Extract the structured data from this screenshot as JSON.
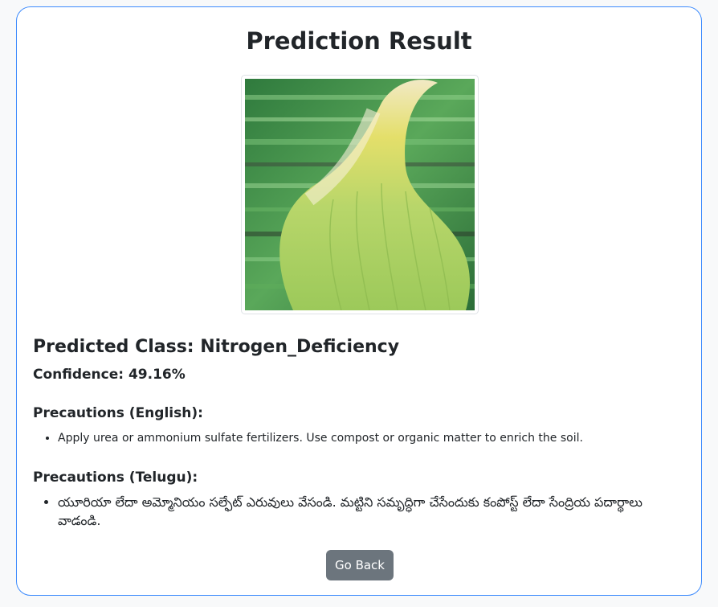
{
  "page": {
    "title": "Prediction Result"
  },
  "result": {
    "predicted_class": "Predicted Class: Nitrogen_Deficiency",
    "confidence": "Confidence: 49.16%"
  },
  "precautions": {
    "english_heading": "Precautions (English):",
    "english_items": [
      "Apply urea or ammonium sulfate fertilizers. Use compost or organic matter to enrich the soil."
    ],
    "telugu_heading": "Precautions (Telugu):",
    "telugu_items": [
      "యూరియా లేదా అమ్మోనియం సల్ఫేట్ ఎరువులు వేసండి. మట్టిని సమృద్ధిగా చేసేందుకు కంపోస్ట్ లేదా సేంద్రియ పదార్థాలు వాడండి."
    ]
  },
  "actions": {
    "go_back_label": "Go Back"
  },
  "colors": {
    "card_border": "#3d8bfd",
    "button_bg": "#6c757d",
    "text": "#212529"
  }
}
